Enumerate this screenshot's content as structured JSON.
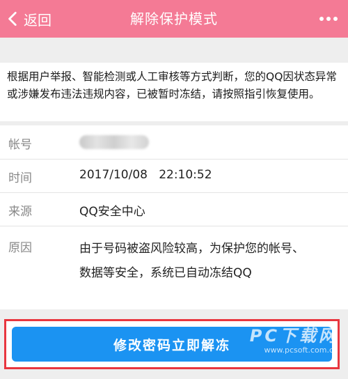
{
  "navbar": {
    "back_label": "返回",
    "title": "解除保护模式",
    "bg_color": "#f47a95"
  },
  "notice": {
    "text": "根据用户举报、智能检测或人工审核等方式判断，您的QQ因状态异常或涉嫌发布违法违规内容，已被暂时冻结，请按照指引恢复使用。"
  },
  "info": {
    "account_label": "帐号",
    "time_label": "时间",
    "time_value": "2017/10/08   22:10:52",
    "source_label": "来源",
    "source_value": "QQ安全中心",
    "reason_label": "原因",
    "reason_value": "由于号码被盗风险较高，为保护您的帐号、数据等安全，系统已自动冻结QQ"
  },
  "action": {
    "unfreeze_label": "修改密码立即解冻",
    "button_color": "#1b93f2",
    "highlight_color": "#e8363f"
  },
  "watermark": {
    "line1": "PC下载网",
    "line2": "www.pcsoft.com.cn"
  }
}
